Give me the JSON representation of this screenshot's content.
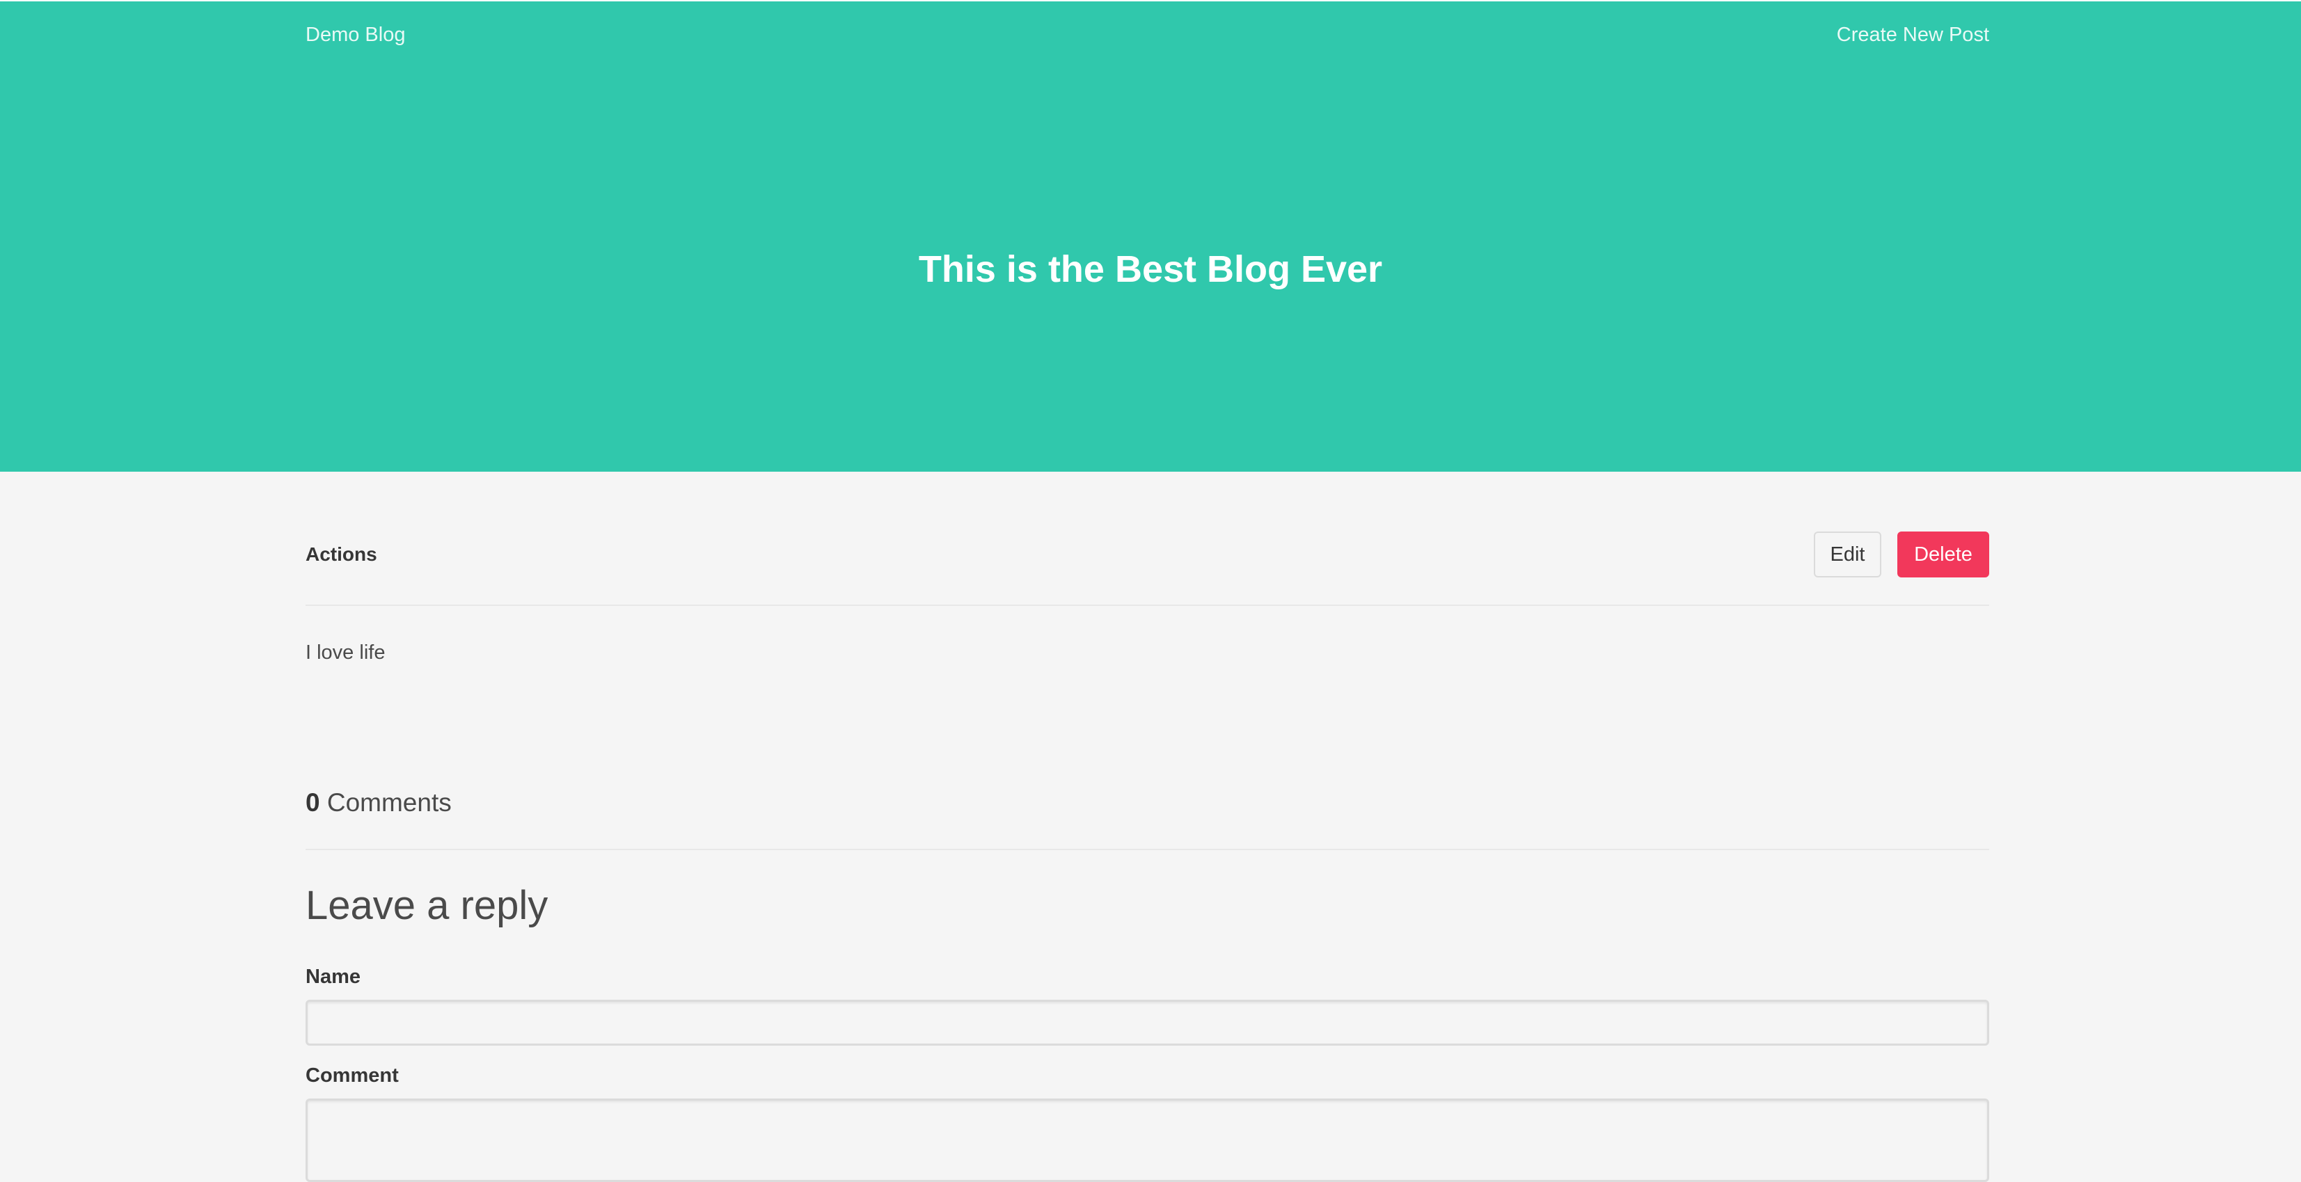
{
  "nav": {
    "brand": "Demo Blog",
    "create_link": "Create New Post"
  },
  "hero": {
    "title": "This is the Best Blog Ever"
  },
  "actions": {
    "label": "Actions",
    "edit_label": "Edit",
    "delete_label": "Delete"
  },
  "post": {
    "body": "I love life"
  },
  "comments": {
    "count": "0",
    "label": "Comments"
  },
  "reply": {
    "title": "Leave a reply",
    "name_label": "Name",
    "name_value": "",
    "comment_label": "Comment",
    "comment_value": ""
  },
  "colors": {
    "hero_bg": "#30c8ac",
    "delete_bg": "#f2385b",
    "page_bg": "#f5f5f5"
  }
}
